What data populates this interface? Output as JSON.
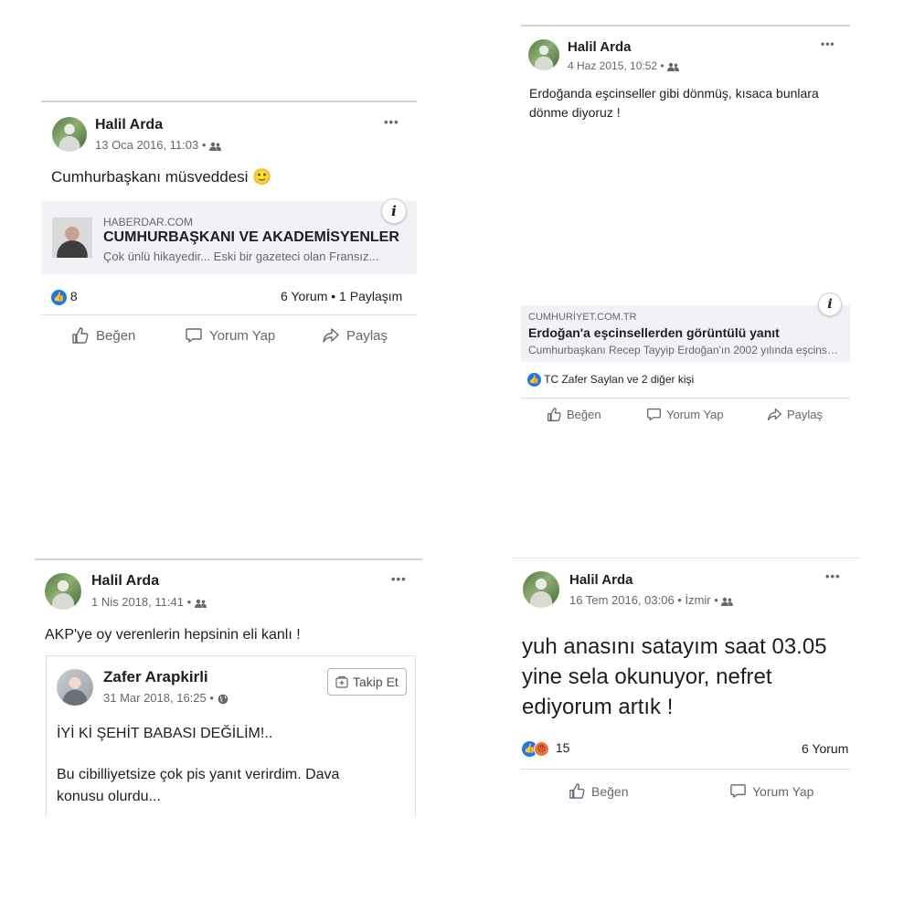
{
  "posts": [
    {
      "author": "Halil Arda",
      "date": "13 Oca 2016, 11:03",
      "text": "Cumhurbaşkanı müsveddesi 🙂",
      "more": "•••",
      "link": {
        "domain": "HABERDAR.COM",
        "title": "CUMHURBAŞKANI VE AKADEMİSYENLER",
        "description": "Çok ünlü hikayedir...   Eski bir gazeteci olan Fransız..."
      },
      "reactions_count": "8",
      "comments_shares": "6 Yorum • 1 Paylaşım",
      "actions": {
        "like": "Beğen",
        "comment": "Yorum Yap",
        "share": "Paylaş"
      }
    },
    {
      "author": "Halil Arda",
      "date": "4 Haz 2015, 10:52",
      "text": "Erdoğanda eşcinseller gibi dönmüş, kısaca bunlara dönme diyoruz !",
      "more": "•••",
      "link": {
        "domain": "CUMHURİYET.COM.TR",
        "title": "Erdoğan'a eşcinsellerden görüntülü yanıt",
        "description": "Cumhurbaşkanı Recep Tayyip Erdoğan'ın 2002 yılında eşcinsel..."
      },
      "reactions_text": "TC Zafer Saylan ve 2 diğer kişi",
      "actions": {
        "like": "Beğen",
        "comment": "Yorum Yap",
        "share": "Paylaş"
      }
    },
    {
      "author": "Halil Arda",
      "date": "1 Nis 2018, 11:41",
      "text": "AKP'ye oy verenlerin hepsinin eli kanlı !",
      "more": "•••",
      "shared": {
        "author": "Zafer Arapkirli",
        "date": "31 Mar 2018, 16:25",
        "follow": "Takip Et",
        "line1": "İYİ Kİ ŞEHİT BABASI DEĞİLİM!..",
        "line2": "Bu cibilliyetsize çok pis yanıt verirdim. Dava konusu olurdu..."
      }
    },
    {
      "author": "Halil Arda",
      "date": "16 Tem 2016, 03:06",
      "location": "İzmir",
      "text": "yuh anasını satayım saat 03.05 yine sela okunuyor, nefret ediyorum artık !",
      "more": "•••",
      "reactions_count": "15",
      "comments": "6 Yorum",
      "actions": {
        "like": "Beğen",
        "comment": "Yorum Yap"
      }
    }
  ],
  "colors": {
    "like_blue": "#1877f2",
    "angry_orange": "#f0713a",
    "link_bg": "#f0f2f5"
  }
}
